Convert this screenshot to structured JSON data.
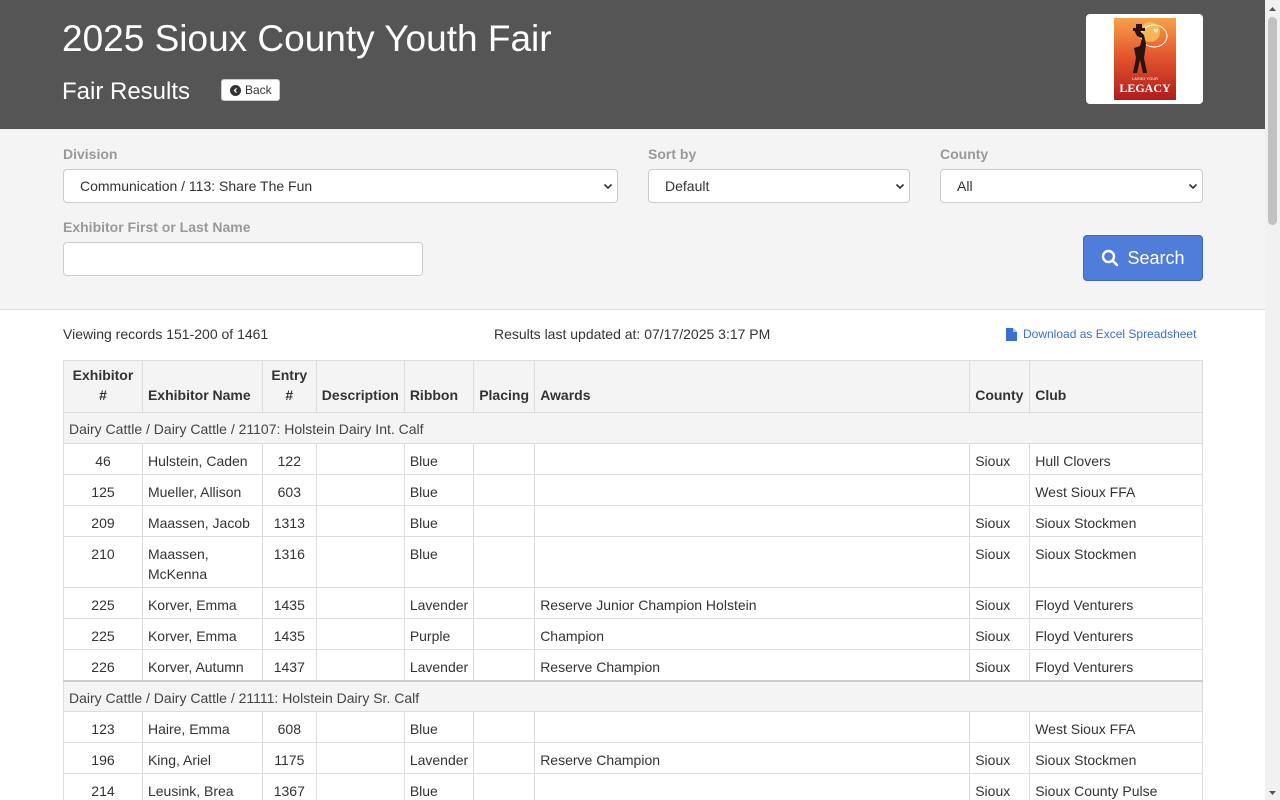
{
  "header": {
    "title": "2025 Sioux County Youth Fair",
    "subtitle": "Fair Results",
    "back_label": "Back",
    "logo_small_text": "LASSO YOUR",
    "logo_word": "LEGACY"
  },
  "filters": {
    "division_label": "Division",
    "division_value": "Communication / 113: Share The Fun",
    "sort_label": "Sort by",
    "sort_value": "Default",
    "county_label": "County",
    "county_value": "All",
    "name_label": "Exhibitor First or Last Name",
    "name_value": "",
    "search_label": "Search"
  },
  "info": {
    "viewing": "Viewing records 151-200 of 1461",
    "updated": "Results last updated at: 07/17/2025 3:17 PM",
    "download": "Download as Excel Spreadsheet"
  },
  "table": {
    "headers": {
      "exhibitor_num_1": "Exhibitor",
      "exhibitor_num_2": "#",
      "exhibitor_name": "Exhibitor Name",
      "entry_num_1": "Entry",
      "entry_num_2": "#",
      "description": "Description",
      "ribbon": "Ribbon",
      "placing": "Placing",
      "awards": "Awards",
      "county": "County",
      "club": "Club"
    },
    "group1": "Dairy Cattle / Dairy Cattle / 21107: Holstein Dairy Int. Calf",
    "group2": "Dairy Cattle / Dairy Cattle / 21111: Holstein Dairy Sr. Calf",
    "rows1": [
      {
        "ex": "46",
        "name": "Hulstein, Caden",
        "entry": "122",
        "desc": "",
        "ribbon": "Blue",
        "placing": "",
        "awards": "",
        "county": "Sioux",
        "club": "Hull Clovers"
      },
      {
        "ex": "125",
        "name": "Mueller, Allison",
        "entry": "603",
        "desc": "",
        "ribbon": "Blue",
        "placing": "",
        "awards": "",
        "county": "",
        "club": "West Sioux FFA"
      },
      {
        "ex": "209",
        "name": "Maassen, Jacob",
        "entry": "1313",
        "desc": "",
        "ribbon": "Blue",
        "placing": "",
        "awards": "",
        "county": "Sioux",
        "club": "Sioux Stockmen"
      },
      {
        "ex": "210",
        "name_1": "Maassen,",
        "name_2": "McKenna",
        "entry": "1316",
        "desc": "",
        "ribbon": "Blue",
        "placing": "",
        "awards": "",
        "county": "Sioux",
        "club": "Sioux Stockmen"
      },
      {
        "ex": "225",
        "name": "Korver, Emma",
        "entry": "1435",
        "desc": "",
        "ribbon": "Lavender",
        "placing": "",
        "awards": "Reserve Junior Champion Holstein",
        "county": "Sioux",
        "club": "Floyd Venturers"
      },
      {
        "ex": "225",
        "name": "Korver, Emma",
        "entry": "1435",
        "desc": "",
        "ribbon": "Purple",
        "placing": "",
        "awards": "Champion",
        "county": "Sioux",
        "club": "Floyd Venturers"
      },
      {
        "ex": "226",
        "name": "Korver, Autumn",
        "entry": "1437",
        "desc": "",
        "ribbon": "Lavender",
        "placing": "",
        "awards": "Reserve Champion",
        "county": "Sioux",
        "club": "Floyd Venturers"
      }
    ],
    "rows2": [
      {
        "ex": "123",
        "name": "Haire, Emma",
        "entry": "608",
        "desc": "",
        "ribbon": "Blue",
        "placing": "",
        "awards": "",
        "county": "",
        "club": "West Sioux FFA"
      },
      {
        "ex": "196",
        "name": "King, Ariel",
        "entry": "1175",
        "desc": "",
        "ribbon": "Lavender",
        "placing": "",
        "awards": "Reserve Champion",
        "county": "Sioux",
        "club": "Sioux Stockmen"
      },
      {
        "ex": "214",
        "name": "Leusink, Brea",
        "entry": "1367",
        "desc": "",
        "ribbon": "Blue",
        "placing": "",
        "awards": "",
        "county": "Sioux",
        "club": "Sioux County Pulse"
      }
    ]
  },
  "colors": {
    "header_bg": "#555555",
    "filter_bg": "#f4f4f4",
    "accent": "#4f7dd9",
    "link": "#3a6fd0"
  },
  "icons": {
    "back": "arrow-circle-left-icon",
    "search": "search-icon",
    "download": "file-icon",
    "select": "chevron-down-icon"
  }
}
